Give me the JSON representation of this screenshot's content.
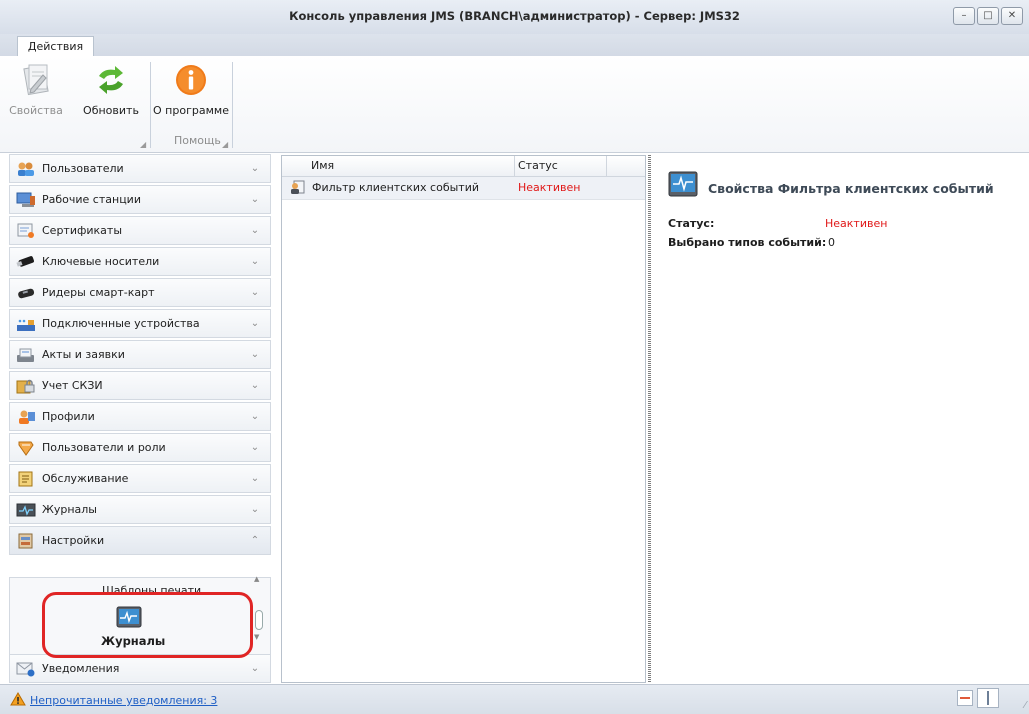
{
  "window": {
    "title": "Консоль управления JMS (BRANCH\\администратор) - Сервер: JMS32",
    "minimize_icon": "minimize-icon",
    "maximize_icon": "maximize-icon",
    "close_icon": "close-icon"
  },
  "ribbon": {
    "tabs": [
      {
        "label": "Действия"
      }
    ],
    "buttons": [
      {
        "label": "Свойства",
        "icon": "properties-icon",
        "enabled": false
      },
      {
        "label": "Обновить",
        "icon": "refresh-icon",
        "enabled": true
      },
      {
        "label": "О программе",
        "icon": "info-icon",
        "enabled": true
      }
    ],
    "groups": [
      {
        "label": ""
      },
      {
        "label": "Помощь"
      }
    ]
  },
  "sidebar": {
    "items": [
      {
        "label": "Пользователи",
        "icon": "users-icon"
      },
      {
        "label": "Рабочие станции",
        "icon": "workstations-icon"
      },
      {
        "label": "Сертификаты",
        "icon": "certificates-icon"
      },
      {
        "label": "Ключевые носители",
        "icon": "key-token-icon"
      },
      {
        "label": "Ридеры смарт-карт",
        "icon": "smartcard-reader-icon"
      },
      {
        "label": "Подключенные устройства",
        "icon": "devices-icon"
      },
      {
        "label": "Акты и заявки",
        "icon": "acts-icon"
      },
      {
        "label": "Учет СКЗИ",
        "icon": "crypto-accounting-icon"
      },
      {
        "label": "Профили",
        "icon": "profiles-icon"
      },
      {
        "label": "Пользователи и роли",
        "icon": "roles-icon"
      },
      {
        "label": "Обслуживание",
        "icon": "maintenance-icon"
      },
      {
        "label": "Журналы",
        "icon": "journals-icon"
      },
      {
        "label": "Настройки",
        "icon": "settings-icon",
        "expanded": true
      },
      {
        "label": "Уведомления",
        "icon": "notifications-icon"
      }
    ],
    "settings_subitems": [
      {
        "label": "Шаблоны печати"
      },
      {
        "label": "Журналы",
        "icon": "journal-monitor-icon",
        "selected": true
      }
    ]
  },
  "grid": {
    "columns": [
      "Имя",
      "Статус"
    ],
    "rows": [
      {
        "name": "Фильтр клиентских событий",
        "status": "Неактивен",
        "icon": "filter-icon"
      }
    ]
  },
  "details": {
    "title": "Свойства Фильтра клиентских событий",
    "icon": "journal-monitor-icon",
    "properties": [
      {
        "label": "Статус:",
        "value": "Неактивен"
      },
      {
        "label": "Выбрано типов событий:",
        "value": "0"
      }
    ]
  },
  "statusbar": {
    "notification_link": "Непрочитанные уведомления: 3",
    "warning_icon": "warning-icon"
  },
  "colors": {
    "inactive_status": "#e01818",
    "highlight": "#e02525",
    "link": "#1f5fc5"
  }
}
